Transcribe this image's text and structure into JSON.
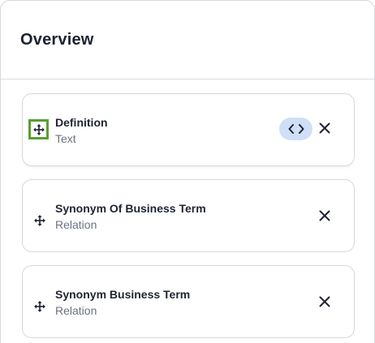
{
  "panel": {
    "title": "Overview"
  },
  "fields": [
    {
      "name": "Definition",
      "type": "Text",
      "selected": true,
      "has_code_toggle": true
    },
    {
      "name": "Synonym Of Business Term",
      "type": "Relation",
      "selected": false,
      "has_code_toggle": false
    },
    {
      "name": "Synonym Business Term",
      "type": "Relation",
      "selected": false,
      "has_code_toggle": false
    }
  ],
  "icons": {
    "drag": "drag-move-icon",
    "code": "code-brackets-icon",
    "close": "close-icon"
  },
  "colors": {
    "selection_outline": "#5a9e2f",
    "code_toggle_bg": "#cfdff7",
    "text_primary": "#1f2433",
    "text_secondary": "#6b7180"
  }
}
